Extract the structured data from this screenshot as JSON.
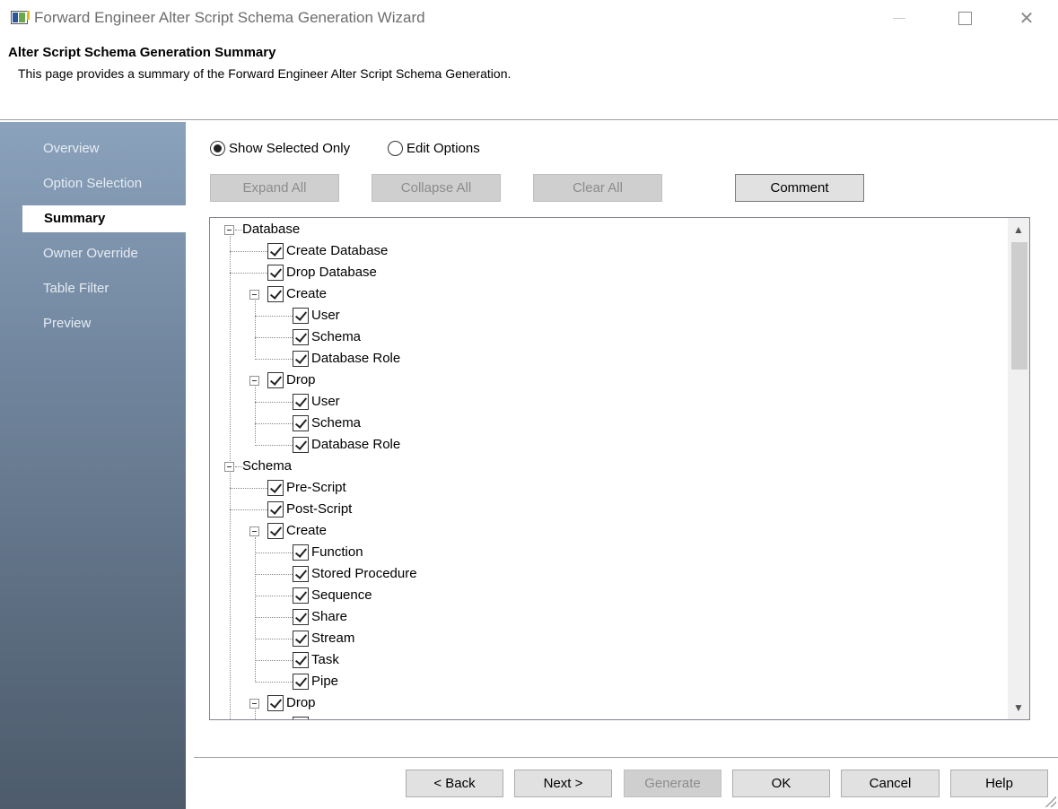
{
  "window": {
    "title": "Forward Engineer Alter Script Schema Generation Wizard",
    "icon": "app-icon"
  },
  "page": {
    "heading": "Alter Script Schema Generation Summary",
    "description": "This page provides a summary of the Forward Engineer Alter Script Schema Generation."
  },
  "sidebar": {
    "items": [
      {
        "label": "Overview",
        "active": false
      },
      {
        "label": "Option Selection",
        "active": false
      },
      {
        "label": "Summary",
        "active": true
      },
      {
        "label": "Owner Override",
        "active": false
      },
      {
        "label": "Table Filter",
        "active": false
      },
      {
        "label": "Preview",
        "active": false
      }
    ]
  },
  "view_mode": {
    "show_selected": "Show Selected Only",
    "edit_options": "Edit Options",
    "selected": "show_selected"
  },
  "toolbar": {
    "expand_all": "Expand All",
    "collapse_all": "Collapse All",
    "clear_all": "Clear All",
    "comment": "Comment"
  },
  "tree": {
    "database": {
      "label": "Database",
      "create_database": "Create Database",
      "drop_database": "Drop Database",
      "create": {
        "label": "Create",
        "items": [
          "User",
          "Schema",
          "Database Role"
        ]
      },
      "drop": {
        "label": "Drop",
        "items": [
          "User",
          "Schema",
          "Database Role"
        ]
      }
    },
    "schema": {
      "label": "Schema",
      "pre_script": "Pre-Script",
      "post_script": "Post-Script",
      "create": {
        "label": "Create",
        "items": [
          "Function",
          "Stored Procedure",
          "Sequence",
          "Share",
          "Stream",
          "Task",
          "Pipe"
        ]
      },
      "drop": {
        "label": "Drop"
      }
    }
  },
  "footer": {
    "back": "< Back",
    "next": "Next >",
    "generate": "Generate",
    "ok": "OK",
    "cancel": "Cancel",
    "help": "Help"
  }
}
